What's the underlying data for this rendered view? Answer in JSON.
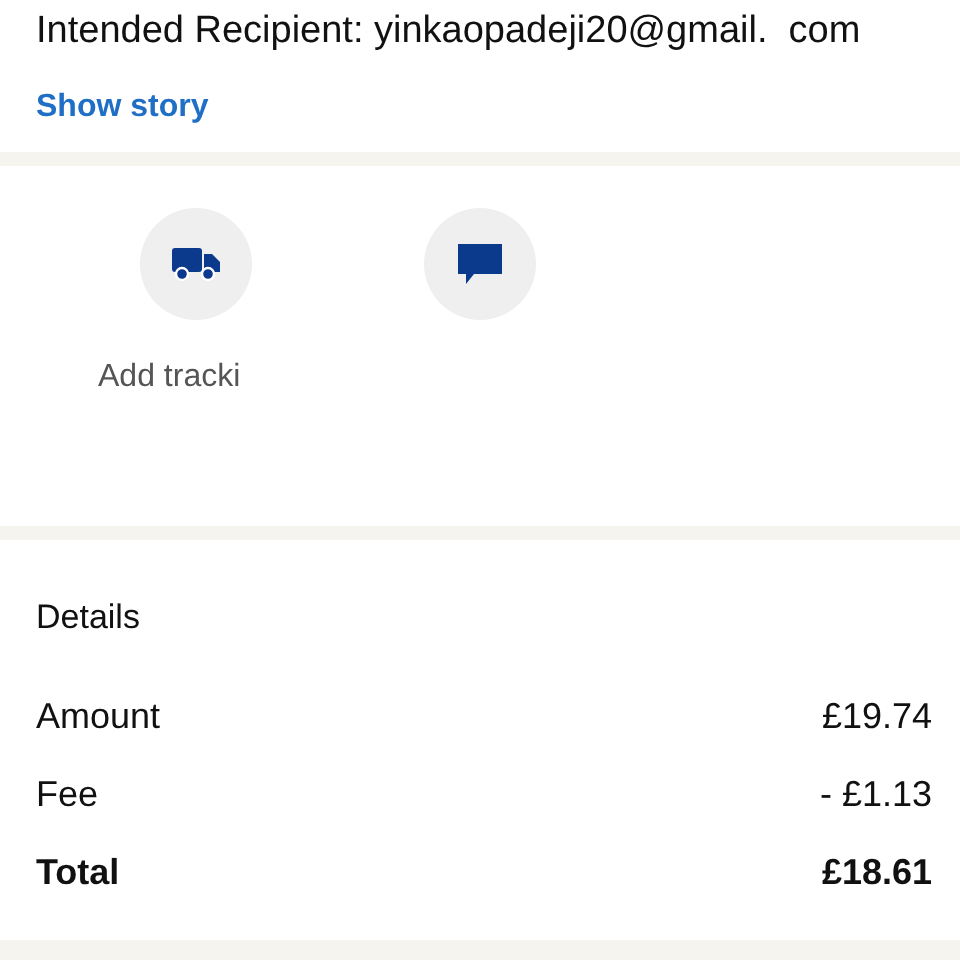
{
  "recipient": "Intended Recipient: yinkaopadeji20@gmail.  com",
  "show_story": "Show story",
  "actions": [
    {
      "kind": "truck",
      "label": "Add tracki"
    },
    {
      "kind": "message"
    }
  ],
  "details": {
    "title": "Details",
    "rows": [
      {
        "label": "Amount",
        "value": "£19.74",
        "kind": "normal"
      },
      {
        "label": "Fee",
        "value": "- £1.13",
        "kind": "normal"
      },
      {
        "label": "Total",
        "value": "£18.61",
        "kind": "total"
      }
    ]
  }
}
